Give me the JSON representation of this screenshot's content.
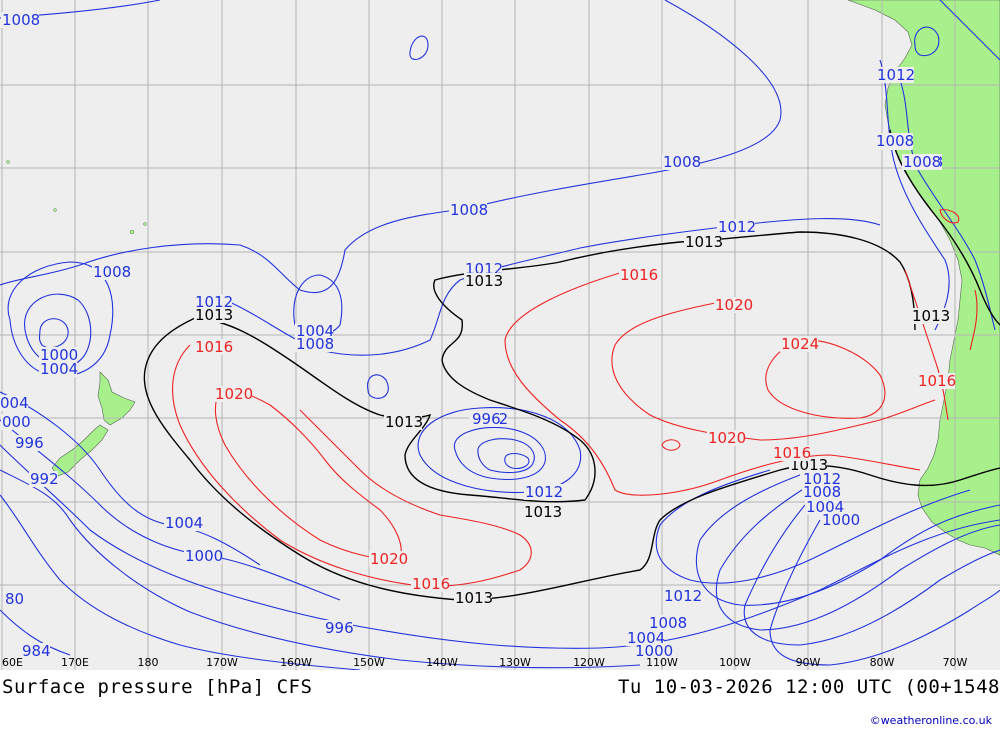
{
  "footer": {
    "title": "Surface pressure [hPa] CFS",
    "datetime": "Tu 10-03-2026 12:00 UTC (00+1548",
    "credit": "©weatheronline.co.uk"
  },
  "map": {
    "longitude_ticks": [
      "60E",
      "170E",
      "180",
      "170W",
      "160W",
      "150W",
      "140W",
      "130W",
      "120W",
      "110W",
      "100W",
      "90W",
      "80W",
      "70W"
    ],
    "colors": {
      "ocean": "#eeeeee",
      "land": "#a8f08c",
      "grid": "#b4b4b4",
      "isobar_low": "#2233dd",
      "isobar_standard": "#000000",
      "isobar_high": "#ee2222"
    },
    "isobar_labels": [
      {
        "text": "1008",
        "color": "blue"
      },
      {
        "text": "1008",
        "color": "blue"
      },
      {
        "text": "1008",
        "color": "blue"
      },
      {
        "text": "1008",
        "color": "blue"
      },
      {
        "text": "1008",
        "color": "blue"
      },
      {
        "text": "1012",
        "color": "blue"
      },
      {
        "text": "1012",
        "color": "blue"
      },
      {
        "text": "1012",
        "color": "blue"
      },
      {
        "text": "1012",
        "color": "blue"
      },
      {
        "text": "1012",
        "color": "blue"
      },
      {
        "text": "1013",
        "color": "black"
      },
      {
        "text": "1013",
        "color": "black"
      },
      {
        "text": "1013",
        "color": "black"
      },
      {
        "text": "1013",
        "color": "black"
      },
      {
        "text": "1013",
        "color": "black"
      },
      {
        "text": "1013",
        "color": "black"
      },
      {
        "text": "1016",
        "color": "red"
      },
      {
        "text": "1016",
        "color": "red"
      },
      {
        "text": "1016",
        "color": "red"
      },
      {
        "text": "1016",
        "color": "red"
      },
      {
        "text": "1020",
        "color": "red"
      },
      {
        "text": "1020",
        "color": "red"
      },
      {
        "text": "1020",
        "color": "red"
      },
      {
        "text": "1024",
        "color": "red"
      },
      {
        "text": "1004",
        "color": "blue"
      },
      {
        "text": "1008",
        "color": "blue"
      },
      {
        "text": "1000",
        "color": "blue"
      },
      {
        "text": "1004",
        "color": "blue"
      },
      {
        "text": "004",
        "color": "blue"
      },
      {
        "text": "000",
        "color": "blue"
      },
      {
        "text": "996",
        "color": "blue"
      },
      {
        "text": "992",
        "color": "blue"
      },
      {
        "text": "1004",
        "color": "blue"
      },
      {
        "text": "1000",
        "color": "blue"
      },
      {
        "text": "80",
        "color": "blue"
      },
      {
        "text": "984",
        "color": "blue"
      },
      {
        "text": "996",
        "color": "blue"
      },
      {
        "text": "1013",
        "color": "black"
      },
      {
        "text": "1020",
        "color": "red"
      },
      {
        "text": "1016",
        "color": "red"
      },
      {
        "text": "1013",
        "color": "black"
      },
      {
        "text": "1012",
        "color": "blue"
      },
      {
        "text": "1008",
        "color": "blue"
      },
      {
        "text": "1004",
        "color": "blue"
      },
      {
        "text": "1000",
        "color": "blue"
      },
      {
        "text": "996",
        "color": "blue"
      },
      {
        "text": "1012",
        "color": "blue"
      },
      {
        "text": "1008",
        "color": "blue"
      },
      {
        "text": "1008",
        "color": "blue"
      },
      {
        "text": "1013",
        "color": "black"
      },
      {
        "text": "1012",
        "color": "blue"
      },
      {
        "text": "1008",
        "color": "blue"
      },
      {
        "text": "1004",
        "color": "blue"
      },
      {
        "text": "1000",
        "color": "blue"
      },
      {
        "text": "996",
        "color": "blue"
      }
    ]
  }
}
